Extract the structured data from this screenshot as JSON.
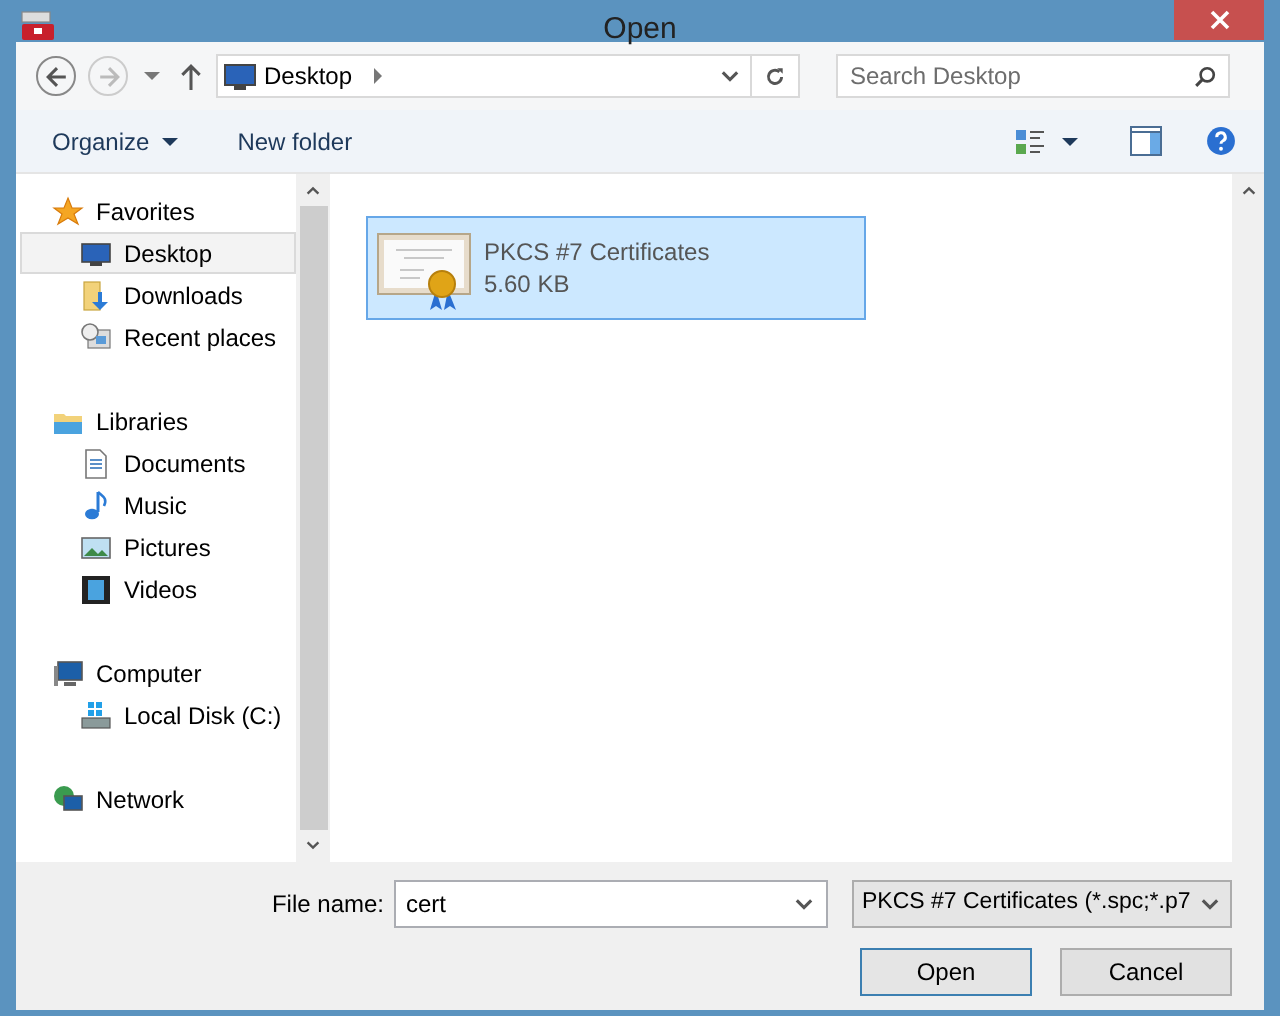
{
  "window": {
    "title": "Open"
  },
  "address": {
    "location": "Desktop",
    "search_placeholder": "Search Desktop"
  },
  "toolbar": {
    "organize": "Organize",
    "new_folder": "New folder"
  },
  "sidebar": {
    "groups": [
      {
        "label": "Favorites",
        "children": [
          {
            "label": "Desktop",
            "selected": true
          },
          {
            "label": "Downloads",
            "selected": false
          },
          {
            "label": "Recent places",
            "selected": false
          }
        ]
      },
      {
        "label": "Libraries",
        "children": [
          {
            "label": "Documents",
            "selected": false
          },
          {
            "label": "Music",
            "selected": false
          },
          {
            "label": "Pictures",
            "selected": false
          },
          {
            "label": "Videos",
            "selected": false
          }
        ]
      },
      {
        "label": "Computer",
        "children": [
          {
            "label": "Local Disk (C:)",
            "selected": false
          }
        ]
      },
      {
        "label": "Network"
      }
    ]
  },
  "files": [
    {
      "name": "PKCS #7 Certificates",
      "size": "5.60 KB",
      "selected": true
    }
  ],
  "footer": {
    "file_name_label": "File name:",
    "file_name": "cert",
    "file_type": "PKCS #7 Certificates (*.spc;*.p7",
    "open": "Open",
    "cancel": "Cancel"
  }
}
